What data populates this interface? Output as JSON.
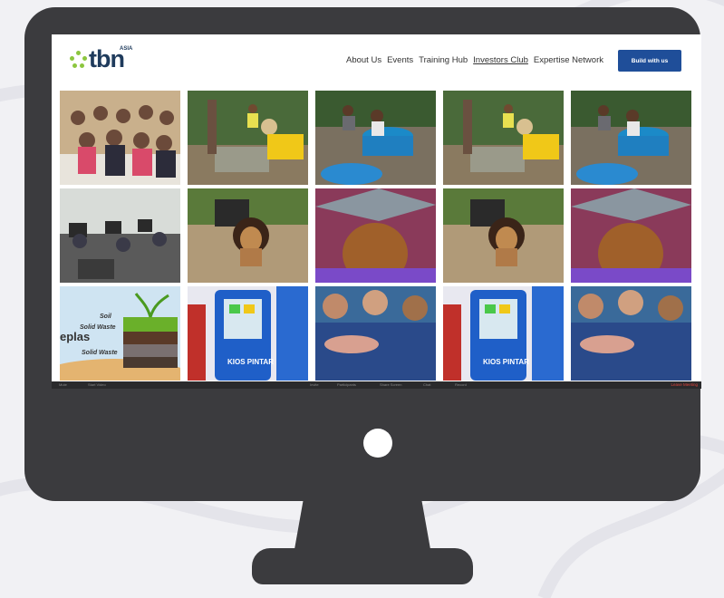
{
  "site": {
    "logo_text": "tbn",
    "logo_superscript": "ASIA",
    "nav": [
      {
        "label": "About Us"
      },
      {
        "label": "Events"
      },
      {
        "label": "Training Hub"
      },
      {
        "label": "Investors Club",
        "active": true
      },
      {
        "label": "Expertise Network"
      }
    ],
    "cta_label": "Build with us"
  },
  "tiles": {
    "kios": "KIOS PINTAR",
    "soil_lines": [
      "Soil",
      "Solid Waste",
      "Solid Waste"
    ],
    "plas": "eplas"
  },
  "meeting_bar": {
    "items": [
      "Mute",
      "Start Video",
      "Invite",
      "Participants",
      "Share Screen",
      "Chat",
      "Record"
    ],
    "leave": "Leave Meeting"
  },
  "colors": {
    "monitor": "#3b3b3e",
    "brand_navy": "#1f3b5c",
    "brand_green": "#8cc63f",
    "cta": "#1f4e99"
  }
}
